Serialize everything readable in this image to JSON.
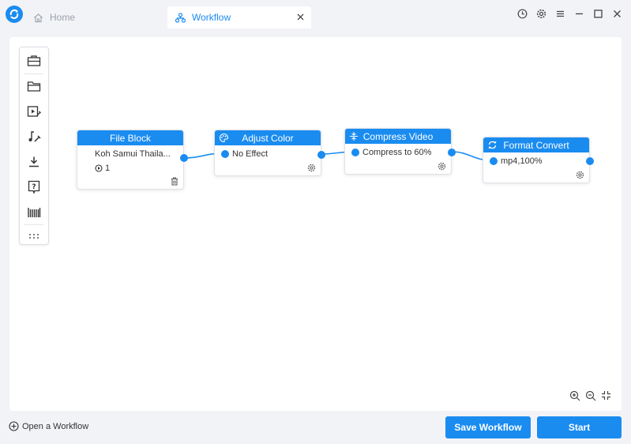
{
  "tabs": [
    {
      "label": "Home",
      "icon": "home-icon"
    },
    {
      "label": "Workflow",
      "icon": "workflow-icon"
    }
  ],
  "window_controls": [
    "history-icon",
    "settings-icon",
    "menu-icon",
    "minimize-icon",
    "maximize-icon",
    "close-icon"
  ],
  "palette": [
    "toolbox-icon",
    "folder-icon",
    "video-edit-icon",
    "audio-edit-icon",
    "download-icon",
    "help-icon",
    "barcode-icon",
    "more-icon"
  ],
  "nodes": {
    "file_block": {
      "title": "File Block",
      "file": "Koh Samui Thaila...",
      "count": "1"
    },
    "adjust_color": {
      "title": "Adjust Color",
      "value": "No Effect"
    },
    "compress_video": {
      "title": "Compress Video",
      "value": "Compress to 60%"
    },
    "format_convert": {
      "title": "Format Convert",
      "value": "mp4,100%"
    }
  },
  "footer": {
    "open_workflow": "Open a Workflow",
    "save_workflow": "Save Workflow",
    "start": "Start"
  },
  "colors": {
    "accent": "#1a8cf0",
    "background": "#f2f3f7"
  }
}
